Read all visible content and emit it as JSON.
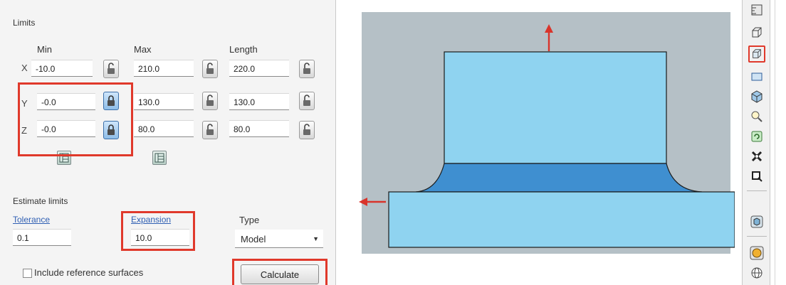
{
  "limits": {
    "title": "Limits",
    "columns": {
      "min": "Min",
      "max": "Max",
      "length": "Length"
    },
    "rows": [
      {
        "axis": "X",
        "min": "-10.0",
        "max": "210.0",
        "length": "220.0",
        "min_locked": false
      },
      {
        "axis": "Y",
        "min": "-0.0",
        "max": "130.0",
        "length": "130.0",
        "min_locked": true
      },
      {
        "axis": "Z",
        "min": "-0.0",
        "max": "80.0",
        "length": "80.0",
        "min_locked": true
      }
    ]
  },
  "estimate": {
    "title": "Estimate limits",
    "tolerance_label": "Tolerance",
    "tolerance_value": "0.1",
    "expansion_label": "Expansion",
    "expansion_value": "10.0",
    "type_label": "Type",
    "type_value": "Model"
  },
  "include_reference": {
    "label": "Include reference surfaces",
    "checked": false
  },
  "calculate_label": "Calculate",
  "colors": {
    "highlight": "#e0392b",
    "model_light": "#8fd3f0",
    "model_band": "#3f8fd0",
    "arrow": "#d9342b",
    "link": "#2f5fb3",
    "lock_active": "#8ebde8"
  },
  "toolbar_icons": [
    "ruler-icon",
    "wireframe-box-icon",
    "block-view-icon",
    "rectangle-icon",
    "shaded-cube-icon",
    "zoom-icon",
    "refresh-icon",
    "transform-icon",
    "zoom-box-icon",
    "material-cube-icon",
    "sphere-icon",
    "globe-icon"
  ]
}
